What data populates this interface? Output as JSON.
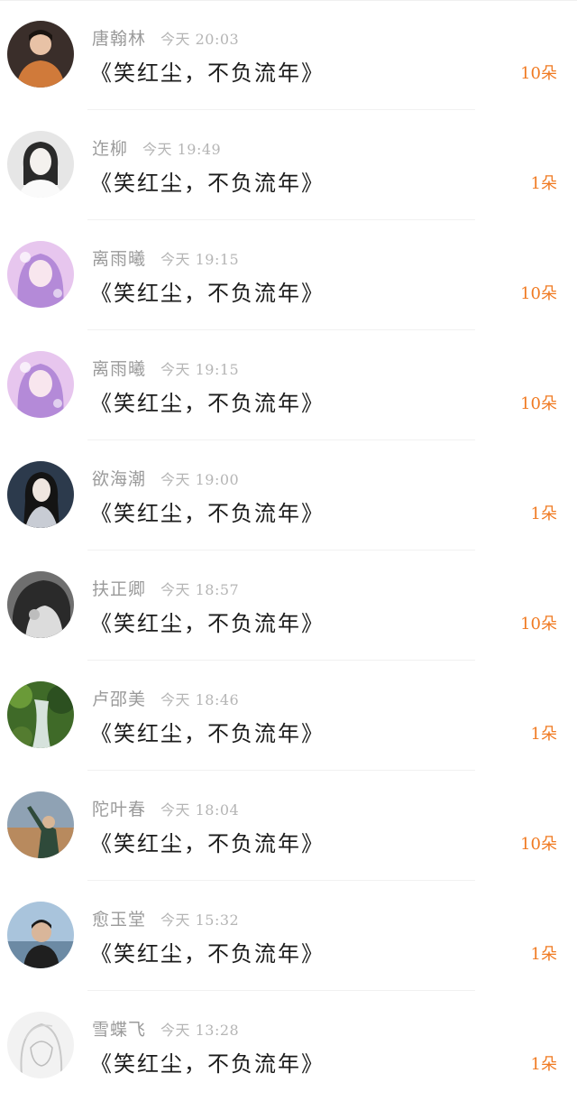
{
  "rows": [
    {
      "name": "唐翰林",
      "time": "今天 20:03",
      "message": "《笑红尘，不负流年》",
      "gift": "10朵",
      "avatar": {
        "icon": "avatar-portrait-icon",
        "bg": "#3a2e2a",
        "accent": "#d07a3a"
      }
    },
    {
      "name": "迮柳",
      "time": "今天 19:49",
      "message": "《笑红尘，不负流年》",
      "gift": "1朵",
      "avatar": {
        "icon": "avatar-portrait-icon",
        "bg": "#e6e6e6",
        "accent": "#2a2a2a"
      }
    },
    {
      "name": "离雨曦",
      "time": "今天 19:15",
      "message": "《笑红尘，不负流年》",
      "gift": "10朵",
      "avatar": {
        "icon": "avatar-anime-girl-icon",
        "bg": "#e7c6ee",
        "accent": "#b48ad8"
      }
    },
    {
      "name": "离雨曦",
      "time": "今天 19:15",
      "message": "《笑红尘，不负流年》",
      "gift": "10朵",
      "avatar": {
        "icon": "avatar-anime-girl-icon",
        "bg": "#e7c6ee",
        "accent": "#b48ad8"
      }
    },
    {
      "name": "欲海潮",
      "time": "今天 19:00",
      "message": "《笑红尘，不负流年》",
      "gift": "1朵",
      "avatar": {
        "icon": "avatar-portrait-icon",
        "bg": "#2c3a4c",
        "accent": "#c8ccd4"
      }
    },
    {
      "name": "扶正卿",
      "time": "今天 18:57",
      "message": "《笑红尘，不负流年》",
      "gift": "10朵",
      "avatar": {
        "icon": "avatar-portrait-icon",
        "bg": "#6f6f6f",
        "accent": "#dcdcdc"
      }
    },
    {
      "name": "卢邵美",
      "time": "今天 18:46",
      "message": "《笑红尘，不负流年》",
      "gift": "1朵",
      "avatar": {
        "icon": "avatar-waterfall-icon",
        "bg": "#3f6a28",
        "accent": "#d6e2dc"
      }
    },
    {
      "name": "陀叶春",
      "time": "今天 18:04",
      "message": "《笑红尘，不负流年》",
      "gift": "10朵",
      "avatar": {
        "icon": "avatar-portrait-icon",
        "bg": "#b88a5e",
        "accent": "#2f4a3a"
      }
    },
    {
      "name": "愈玉堂",
      "time": "今天 15:32",
      "message": "《笑红尘，不负流年》",
      "gift": "1朵",
      "avatar": {
        "icon": "avatar-portrait-icon",
        "bg": "#86a6c2",
        "accent": "#1f1f1f"
      }
    },
    {
      "name": "雪蝶飞",
      "time": "今天 13:28",
      "message": "《笑红尘，不负流年》",
      "gift": "1朵",
      "avatar": {
        "icon": "avatar-sketch-icon",
        "bg": "#f2f2f2",
        "accent": "#c9c9c9"
      }
    }
  ],
  "colors": {
    "gift": "#f07a22",
    "name": "#9a9a9a",
    "time": "#b5b5b5",
    "message": "#1c1c1c"
  }
}
